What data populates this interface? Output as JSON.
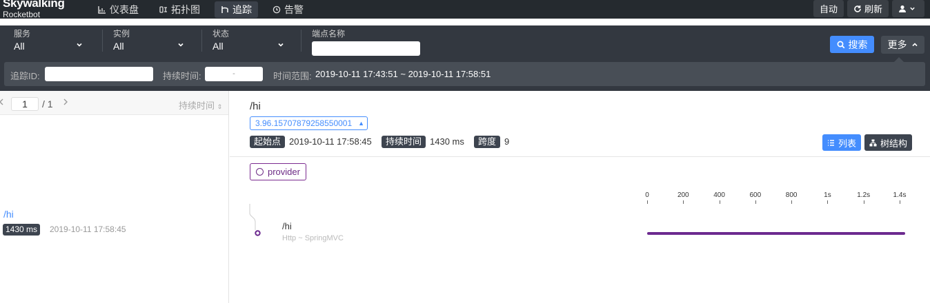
{
  "app": {
    "brand": "Skywalking",
    "product": "Rocketbot"
  },
  "nav": [
    {
      "label": "仪表盘",
      "icon": "dashboard-icon"
    },
    {
      "label": "拓扑图",
      "icon": "topology-icon"
    },
    {
      "label": "追踪",
      "icon": "trace-icon",
      "active": true
    },
    {
      "label": "告警",
      "icon": "alarm-icon"
    }
  ],
  "topright": {
    "auto_label": "自动",
    "refresh_label": "刷新",
    "user_icon": "user-icon"
  },
  "filters": {
    "service": {
      "label": "服务",
      "value": "All"
    },
    "instance": {
      "label": "实例",
      "value": "All"
    },
    "status": {
      "label": "状态",
      "value": "All"
    },
    "endpoint": {
      "label": "端点名称",
      "value": ""
    },
    "search_label": "搜索",
    "more_label": "更多",
    "trace_id_label": "追踪ID:",
    "trace_id_value": "",
    "duration_label": "持续时间:",
    "duration_placeholder": "-",
    "time_range_label": "时间范围:",
    "time_range_value": "2019-10-11 17:43:51 ~ 2019-10-11 17:58:51"
  },
  "list": {
    "page_current": "1",
    "page_total": "/ 1",
    "sort_label": "持续时间",
    "items": [
      {
        "endpoint": "/hi",
        "duration": "1430 ms",
        "start": "2019-10-11 17:58:45"
      }
    ]
  },
  "detail": {
    "title": "/hi",
    "trace_id": "3.96.15707879258550001",
    "start_label": "起始点",
    "start_value": "2019-10-11 17:58:45",
    "duration_label": "持续时间",
    "duration_value": "1430 ms",
    "span_label": "跨度",
    "span_value": "9",
    "list_view_label": "列表",
    "tree_view_label": "树结构",
    "service": "provider",
    "axis_ticks": [
      "0",
      "200",
      "400",
      "600",
      "800",
      "1s",
      "1.2s",
      "1.4s"
    ],
    "span": {
      "name": "/hi",
      "component": "Http ~ SpringMVC",
      "start_ms": 0,
      "duration_ms": 1430
    }
  },
  "colors": {
    "accent": "#448dfe",
    "service": "#6c2a8f",
    "dark": "#252a2f"
  }
}
